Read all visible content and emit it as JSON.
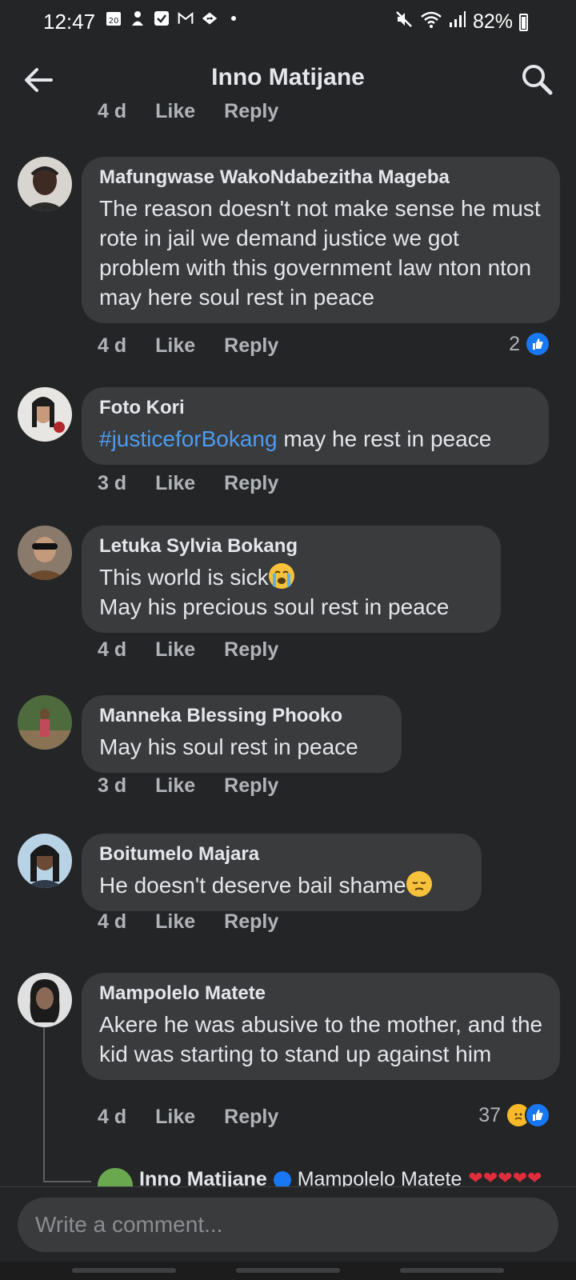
{
  "status_bar": {
    "time": "12:47",
    "calendar_day": "20",
    "battery": "82%"
  },
  "header": {
    "title": "Inno Matijane"
  },
  "partial_prev": {
    "age": "4 d",
    "like": "Like",
    "reply": "Reply"
  },
  "comments": [
    {
      "author": "Mafungwase WakoNdabezitha Mageba",
      "text": "The reason  doesn't  not make sense  he must  rote in jail we demand  justice we got problem with this government  law nton nton may here  soul rest in peace",
      "age": "4 d",
      "like": "Like",
      "reply": "Reply",
      "reaction_count": "2"
    },
    {
      "author": "Foto Kori",
      "hashtag": "#justiceforBokang",
      "text": " may he rest in peace",
      "age": "3 d",
      "like": "Like",
      "reply": "Reply"
    },
    {
      "author": "Letuka Sylvia Bokang",
      "line1": "This world is sick",
      "line2": "May his precious soul rest in peace",
      "age": "4 d",
      "like": "Like",
      "reply": "Reply"
    },
    {
      "author": "Manneka Blessing Phooko",
      "text": "May his soul rest in peace",
      "age": "3 d",
      "like": "Like",
      "reply": "Reply"
    },
    {
      "author": "Boitumelo Majara",
      "text": "He doesn't deserve bail shame",
      "age": "4 d",
      "like": "Like",
      "reply": "Reply"
    },
    {
      "author": "Mampolelo Matete",
      "text": "Akere he was abusive to the mother, and the kid was starting to stand up against him",
      "age": "4 d",
      "like": "Like",
      "reply": "Reply",
      "reaction_count": "37"
    }
  ],
  "reply_preview": {
    "author": "Inno Matjjane",
    "text": "Mampolelo Matete",
    "hearts": "❤❤❤❤❤"
  },
  "composer": {
    "placeholder": "Write a comment..."
  },
  "colors": {
    "background": "#242526",
    "bubble": "#3a3b3c",
    "accent_blue": "#1877f2",
    "hashtag": "#4b9cf2"
  }
}
